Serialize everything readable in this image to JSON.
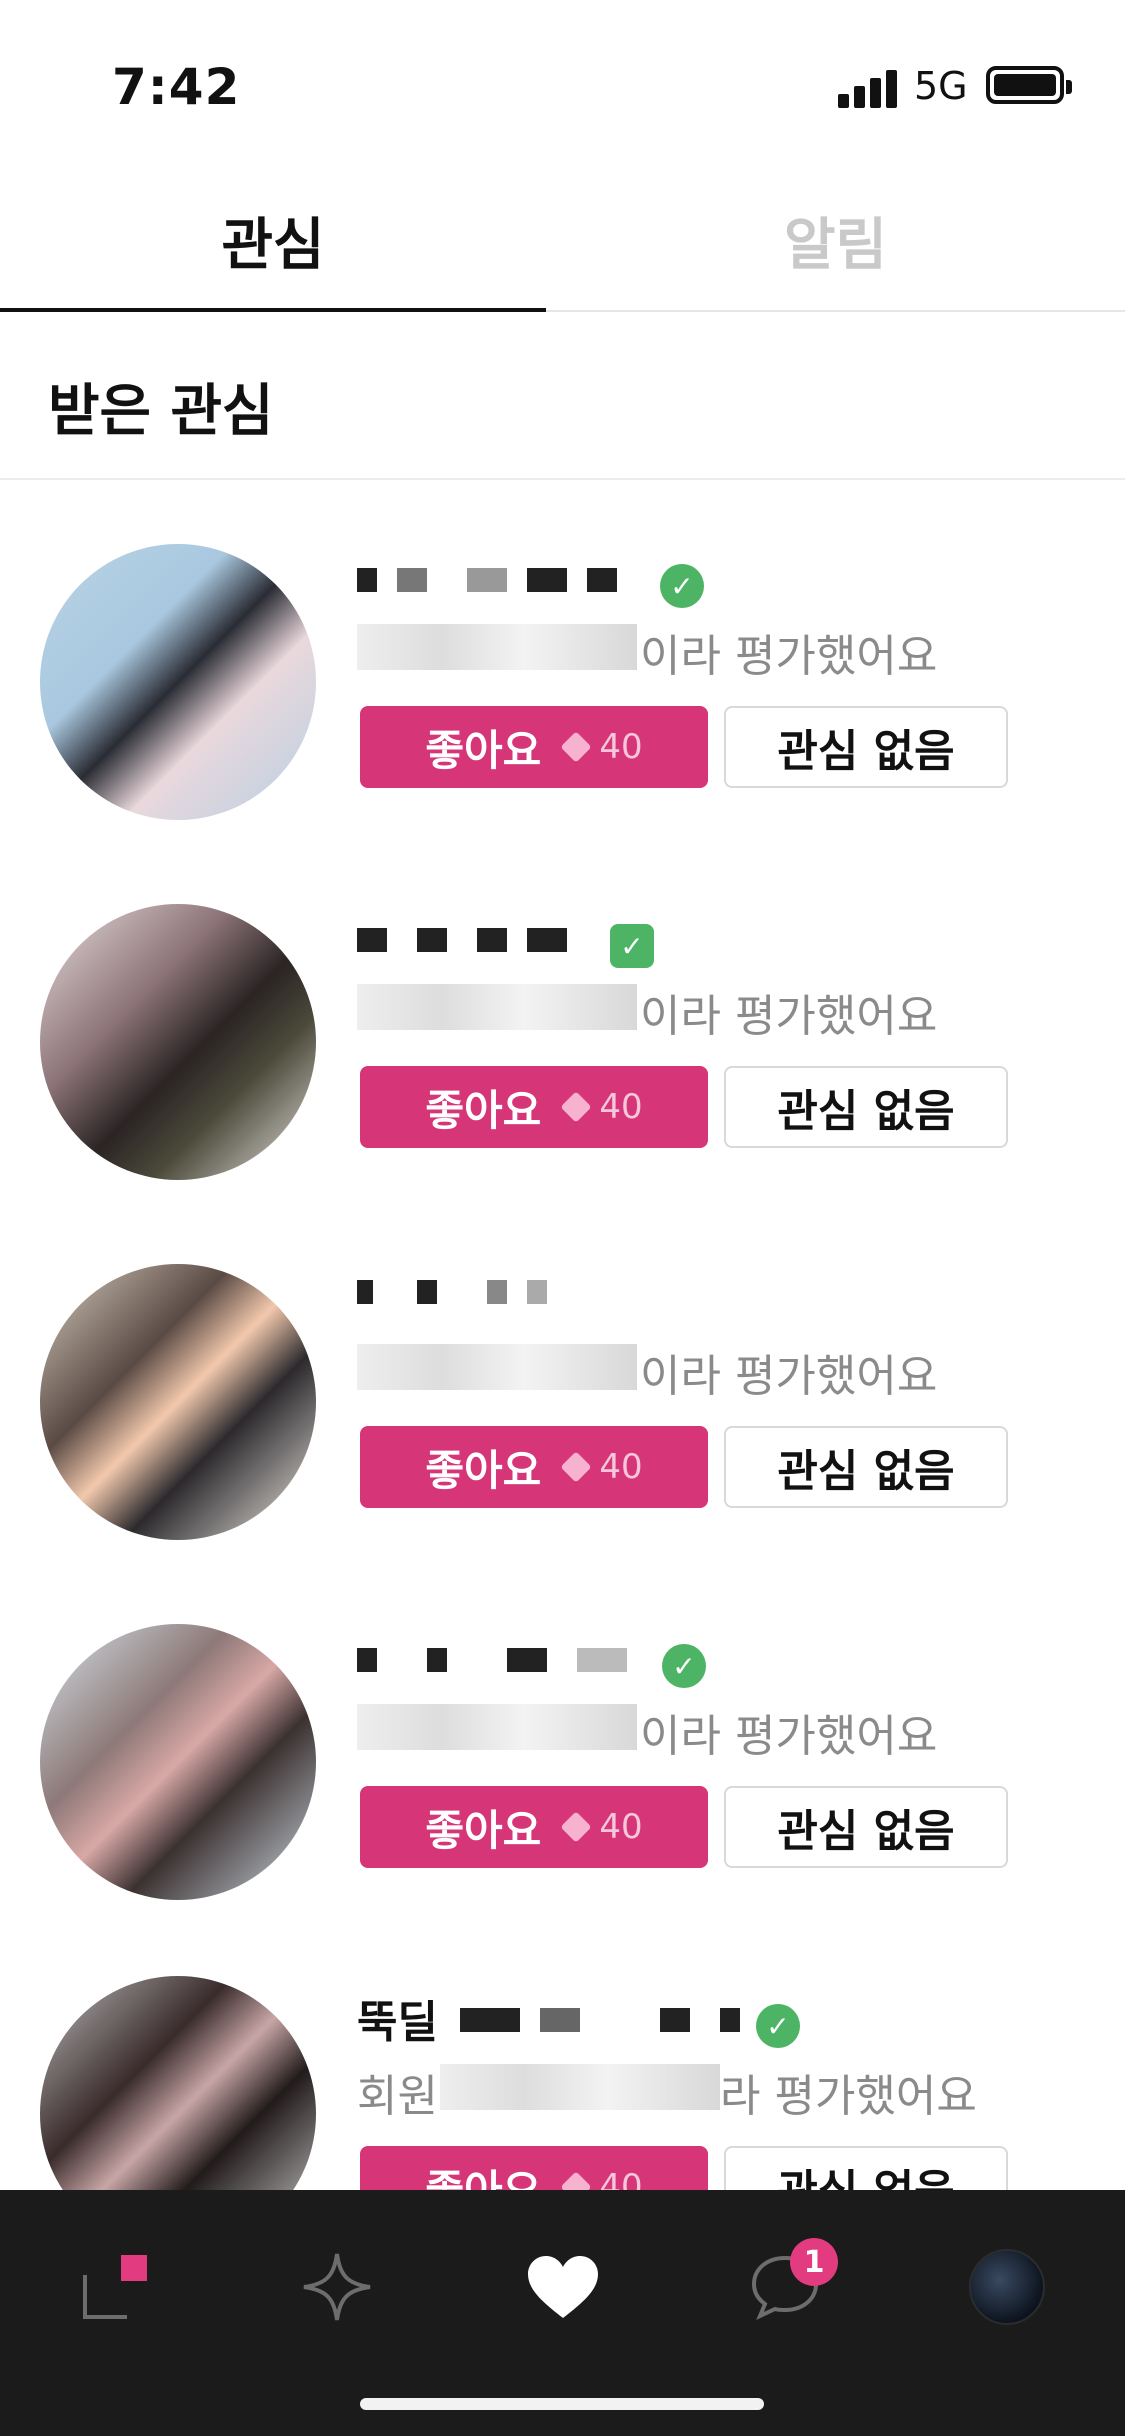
{
  "status_bar": {
    "time": "7:42",
    "network": "5G"
  },
  "tabs": [
    {
      "label": "관심",
      "active": true
    },
    {
      "label": "알림",
      "active": false
    }
  ],
  "section_title": "받은 관심",
  "list": [
    {
      "name": "",
      "verified": true,
      "description_suffix": "이라 평가했어요",
      "like_label": "좋아요",
      "like_cost": "40",
      "no_interest_label": "관심 없음"
    },
    {
      "name": "",
      "verified": false,
      "description_suffix": "이라 평가했어요",
      "like_label": "좋아요",
      "like_cost": "40",
      "no_interest_label": "관심 없음"
    },
    {
      "name": "",
      "verified": false,
      "description_suffix": "이라 평가했어요",
      "like_label": "좋아요",
      "like_cost": "40",
      "no_interest_label": "관심 없음"
    },
    {
      "name": "",
      "verified": true,
      "description_suffix": "이라 평가했어요",
      "like_label": "좋아요",
      "like_cost": "40",
      "no_interest_label": "관심 없음"
    },
    {
      "name": "뚝딜",
      "verified": true,
      "description_prefix": "회원",
      "description_suffix": "라 평가했어요",
      "like_label": "좋아요",
      "like_cost": "40",
      "no_interest_label": "관심 없음"
    }
  ],
  "bottom_nav": {
    "items": [
      "home-icon",
      "sparkle-icon",
      "heart-icon",
      "chat-icon",
      "profile-avatar"
    ],
    "chat_badge": "1"
  },
  "colors": {
    "accent": "#d63578",
    "verified": "#4cb464",
    "nav_bg": "#1b1b1b"
  }
}
